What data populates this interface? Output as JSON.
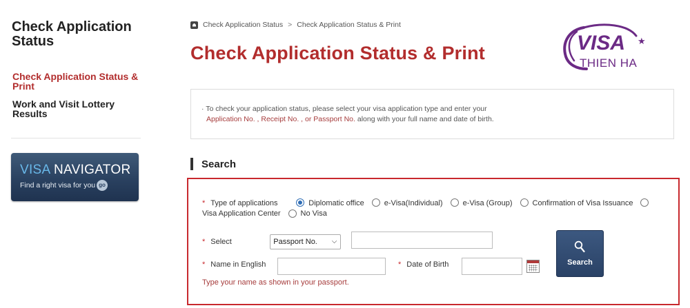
{
  "sidebar": {
    "title": "Check Application Status",
    "items": [
      {
        "label": "Check Application Status & Print"
      },
      {
        "label": "Work and Visit Lottery Results"
      }
    ],
    "banner": {
      "title_part1": "VISA",
      "title_part2": " NAVIGATOR",
      "subtitle": "Find a right visa for you",
      "go_label": "go"
    }
  },
  "breadcrumb": {
    "items": [
      "Check Application Status",
      "Check Application Status & Print"
    ],
    "separator": ">"
  },
  "page_title": "Check Application Status & Print",
  "logo": {
    "main": "VISA",
    "sub": "THIEN HA",
    "star": "★"
  },
  "info": {
    "line1": "· To check your application status, please select your visa application type and enter your",
    "line2_red": "Application No. , Receipt No. , or Passport No.",
    "line2_rest": " along with your full name and date of birth."
  },
  "search": {
    "heading": "Search",
    "required_mark": "*",
    "type_label": "Type of applications",
    "options": [
      {
        "label": "Diplomatic office",
        "checked": true
      },
      {
        "label": "e-Visa(Individual)",
        "checked": false
      },
      {
        "label": "e-Visa (Group)",
        "checked": false
      },
      {
        "label": "Confirmation of Visa Issuance",
        "checked": false
      },
      {
        "label": "Visa Application Center",
        "checked": false
      },
      {
        "label": "No Visa",
        "checked": false
      }
    ],
    "select_label": "Select",
    "select_value": "Passport No.",
    "name_label": "Name in English",
    "dob_label": "Date of Birth",
    "hint": "Type your name as shown in your passport.",
    "button_label": "Search"
  },
  "colors": {
    "accent_red": "#b22d2d",
    "panel_border": "#c8282d",
    "navy": "#2a4266",
    "logo_purple": "#6b2a85"
  }
}
